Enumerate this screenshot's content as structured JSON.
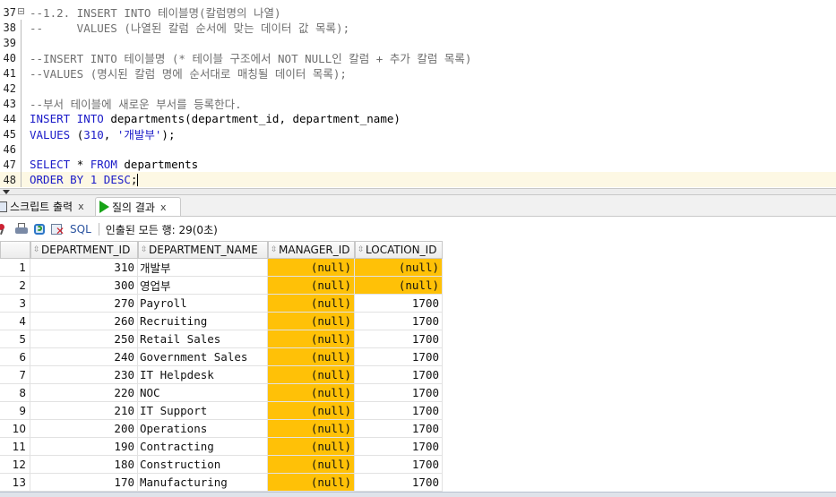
{
  "editor": {
    "lines": [
      {
        "num": "37",
        "segments": [
          {
            "t": "--1.2. INSERT INTO 테이블명(칼럼명의 나열)",
            "c": "cmt"
          }
        ],
        "fold": "box"
      },
      {
        "num": "38",
        "segments": [
          {
            "t": "--     VALUES (나열된 칼럼 순서에 맞는 데이터 값 목록);",
            "c": "cmt"
          }
        ],
        "fold": "line"
      },
      {
        "num": "39",
        "segments": [],
        "fold": "line"
      },
      {
        "num": "40",
        "segments": [
          {
            "t": "--INSERT INTO 테이블명 (* 테이블 구조에서 NOT NULL인 칼럼 + 추가 칼럼 목록)",
            "c": "cmt"
          }
        ],
        "fold": "line"
      },
      {
        "num": "41",
        "segments": [
          {
            "t": "--VALUES (명시된 칼럼 명에 순서대로 매칭될 데이터 목록);",
            "c": "cmt"
          }
        ],
        "fold": "line"
      },
      {
        "num": "42",
        "segments": [],
        "fold": "line"
      },
      {
        "num": "43",
        "segments": [
          {
            "t": "--부서 테이블에 새로운 부서를 등록한다.",
            "c": "cmt"
          }
        ],
        "fold": "line"
      },
      {
        "num": "44",
        "segments": [
          {
            "t": "INSERT INTO ",
            "c": "kw"
          },
          {
            "t": "departments(department_id, department_name)",
            "c": "plain"
          }
        ],
        "fold": "line"
      },
      {
        "num": "45",
        "segments": [
          {
            "t": "VALUES ",
            "c": "kw"
          },
          {
            "t": "(",
            "c": "plain"
          },
          {
            "t": "310",
            "c": "num"
          },
          {
            "t": ", ",
            "c": "plain"
          },
          {
            "t": "'개발부'",
            "c": "str"
          },
          {
            "t": ");",
            "c": "plain"
          }
        ],
        "fold": "line"
      },
      {
        "num": "46",
        "segments": [],
        "fold": "line"
      },
      {
        "num": "47",
        "segments": [
          {
            "t": "SELECT ",
            "c": "kw"
          },
          {
            "t": "* ",
            "c": "plain"
          },
          {
            "t": "FROM ",
            "c": "kw"
          },
          {
            "t": "departments",
            "c": "plain"
          }
        ],
        "fold": "line"
      },
      {
        "num": "48",
        "segments": [
          {
            "t": "ORDER BY ",
            "c": "kw"
          },
          {
            "t": "1 ",
            "c": "num"
          },
          {
            "t": "DESC",
            "c": "kw"
          },
          {
            "t": ";",
            "c": "plain"
          }
        ],
        "fold": "line",
        "current": true
      }
    ]
  },
  "tabs": [
    {
      "label": "스크립트 출력",
      "close": "x",
      "active": false
    },
    {
      "label": "질의 결과",
      "close": "x",
      "active": true
    }
  ],
  "toolbar": {
    "sql_label": "SQL",
    "status": "인출된 모든 행: 29(0초)"
  },
  "grid": {
    "columns": [
      "DEPARTMENT_ID",
      "DEPARTMENT_NAME",
      "MANAGER_ID",
      "LOCATION_ID"
    ],
    "rows": [
      {
        "n": "1",
        "id": "310",
        "name": "개발부",
        "manager": "(null)",
        "location": "(null)"
      },
      {
        "n": "2",
        "id": "300",
        "name": "영업부",
        "manager": "(null)",
        "location": "(null)"
      },
      {
        "n": "3",
        "id": "270",
        "name": "Payroll",
        "manager": "(null)",
        "location": "1700"
      },
      {
        "n": "4",
        "id": "260",
        "name": "Recruiting",
        "manager": "(null)",
        "location": "1700"
      },
      {
        "n": "5",
        "id": "250",
        "name": "Retail Sales",
        "manager": "(null)",
        "location": "1700"
      },
      {
        "n": "6",
        "id": "240",
        "name": "Government Sales",
        "manager": "(null)",
        "location": "1700"
      },
      {
        "n": "7",
        "id": "230",
        "name": "IT Helpdesk",
        "manager": "(null)",
        "location": "1700"
      },
      {
        "n": "8",
        "id": "220",
        "name": "NOC",
        "manager": "(null)",
        "location": "1700"
      },
      {
        "n": "9",
        "id": "210",
        "name": "IT Support",
        "manager": "(null)",
        "location": "1700"
      },
      {
        "n": "10",
        "id": "200",
        "name": "Operations",
        "manager": "(null)",
        "location": "1700"
      },
      {
        "n": "11",
        "id": "190",
        "name": "Contracting",
        "manager": "(null)",
        "location": "1700"
      },
      {
        "n": "12",
        "id": "180",
        "name": "Construction",
        "manager": "(null)",
        "location": "1700"
      },
      {
        "n": "13",
        "id": "170",
        "name": "Manufacturing",
        "manager": "(null)",
        "location": "1700"
      }
    ],
    "null_color": "#ffc107"
  }
}
